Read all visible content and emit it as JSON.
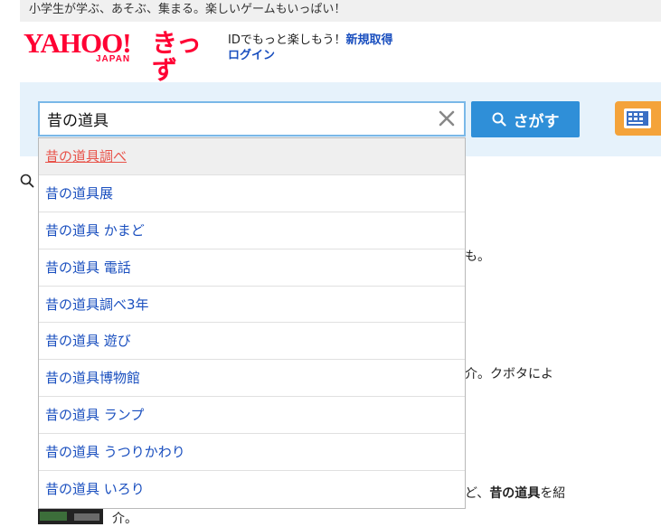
{
  "header": {
    "tagline": "小学生が学ぶ、あそぶ、集まる。楽しいゲームもいっぱい！",
    "logo_yahoo": "YAHOO!",
    "logo_japan": "JAPAN",
    "logo_kids": "きっず",
    "id_text": "IDでもっと楽しもう！",
    "register_link": "新規取得",
    "login_link": "ログイン"
  },
  "search": {
    "query": "昔の道具",
    "button_label": "さがす"
  },
  "suggestions": [
    "昔の道具調べ",
    "昔の道具展",
    "昔の道具 かまど",
    "昔の道具 電話",
    "昔の道具調べ3年",
    "昔の道具 遊び",
    "昔の道具博物館",
    "昔の道具 ランプ",
    "昔の道具 うつりかわり",
    "昔の道具 いろり"
  ],
  "background_results": {
    "fragment1": "も。",
    "fragment2": "介。クボタによ",
    "fragment3_prefix": "ど、",
    "fragment3_bold": "昔の道具",
    "fragment3_suffix": "を紹",
    "fragment4": "介。"
  },
  "colors": {
    "brand_red": "#ff0033",
    "search_button": "#2f8fd8",
    "link_blue": "#1a4fbf",
    "highlight_text": "#e8534a",
    "calc_button": "#f4a33a"
  }
}
